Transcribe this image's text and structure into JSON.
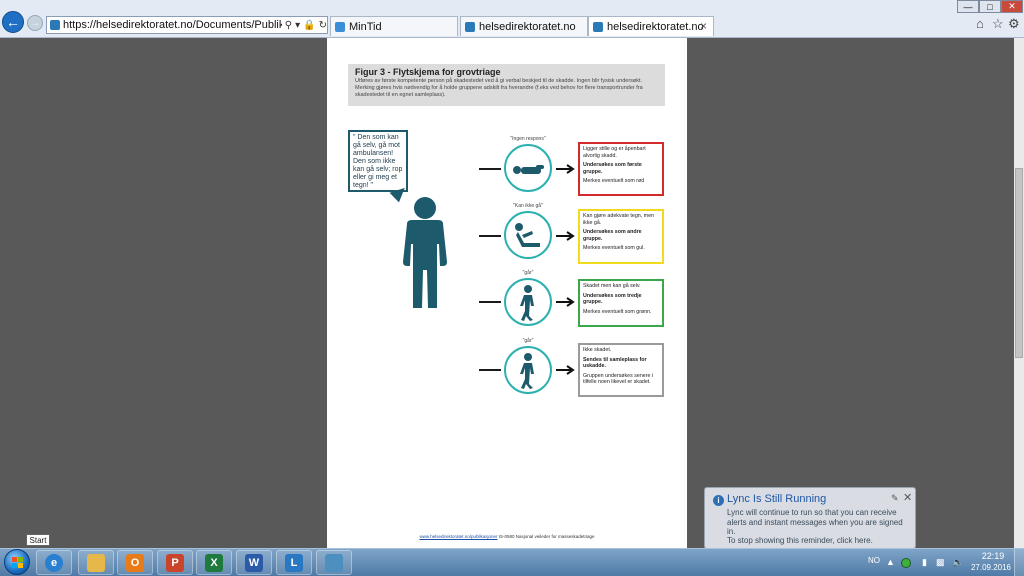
{
  "browser": {
    "url": "https://helsedirektoratet.no/Documents/Publikasjonsvedlegg/IS-",
    "tabs": [
      {
        "label": "MinTid"
      },
      {
        "label": "helsedirektoratet.no"
      },
      {
        "label": "helsedirektoratet.no",
        "active": true
      }
    ],
    "tab_close_glyph": "×"
  },
  "figure": {
    "title": "Figur 3 - Flytskjema for grovtriage",
    "caption": "Utføres av første kompetente person på skadestedet ved å gi verbal beskjed til de skadde. Ingen blir fysisk undersøkt. Merking gjøres hvis nødvendig for å holde gruppene adskilt fra hverandre (f.eks ved behov for flere transportrunder fra skadestedet til en egnet samleplass).",
    "speech": "\" Den som kan gå selv, gå mot ambulansen! Den som ikke kan gå selv; rop eller gi meg et tegn! \"",
    "rows": [
      {
        "label": "\"Ingen respons\"",
        "icon": "lying-person-icon",
        "border_color": "#d42a2a",
        "text": "Ligger stille og er åpenbart alvorlig skadd.",
        "action": "Undersøkes som første gruppe.",
        "note": "Merkes eventuelt som rød"
      },
      {
        "label": "\"Kan ikke gå\"",
        "icon": "sitting-person-icon",
        "border_color": "#f0dc1c",
        "text": "Kan gjøre adekvate tegn, men ikke gå.",
        "action": "Undersøkes som andre gruppe.",
        "note": "Merkes eventuelt som gul."
      },
      {
        "label": "\"går\"",
        "icon": "walking-person-icon",
        "border_color": "#3aa84a",
        "text": "Skadet men kan gå selv.",
        "action": "Undersøkes som tredje gruppe.",
        "note": "Merkes eventuelt som grønn."
      },
      {
        "label": "\"går\"",
        "icon": "walking-person-icon",
        "border_color": "#9a9a9a",
        "text": "Ikke skadet.",
        "action": "Sendes til samleplass for uskadde.",
        "note": "Gruppen undersøkes senere i tilfelle noen likevel er skadet."
      }
    ],
    "footer_link": "www.helsedirektoratet.no/publikasjoner",
    "footer_text": " IS-0580 Nasjonal veileder for masseskadetriage"
  },
  "notification": {
    "title": "Lync Is Still Running",
    "body": "Lync will continue to run so that you can receive alerts and instant messages when you are signed in.",
    "stop": "To stop showing this reminder, click here."
  },
  "taskbar": {
    "start_tooltip": "Start",
    "language": "NO",
    "time": "22:19",
    "date": "27.09.2016",
    "apps": [
      {
        "name": "internet-explorer",
        "color": "#2a7fd1",
        "glyph": "e"
      },
      {
        "name": "file-explorer",
        "color": "#e6b84a",
        "glyph": ""
      },
      {
        "name": "outlook",
        "color": "#e77b18",
        "glyph": "O"
      },
      {
        "name": "powerpoint",
        "color": "#c8452b",
        "glyph": "P"
      },
      {
        "name": "excel",
        "color": "#1f7a3d",
        "glyph": "X"
      },
      {
        "name": "word",
        "color": "#2b5ba8",
        "glyph": "W"
      },
      {
        "name": "lync",
        "color": "#2a78c4",
        "glyph": "L"
      },
      {
        "name": "photo-viewer",
        "color": "#4d8fbf",
        "glyph": ""
      }
    ]
  }
}
